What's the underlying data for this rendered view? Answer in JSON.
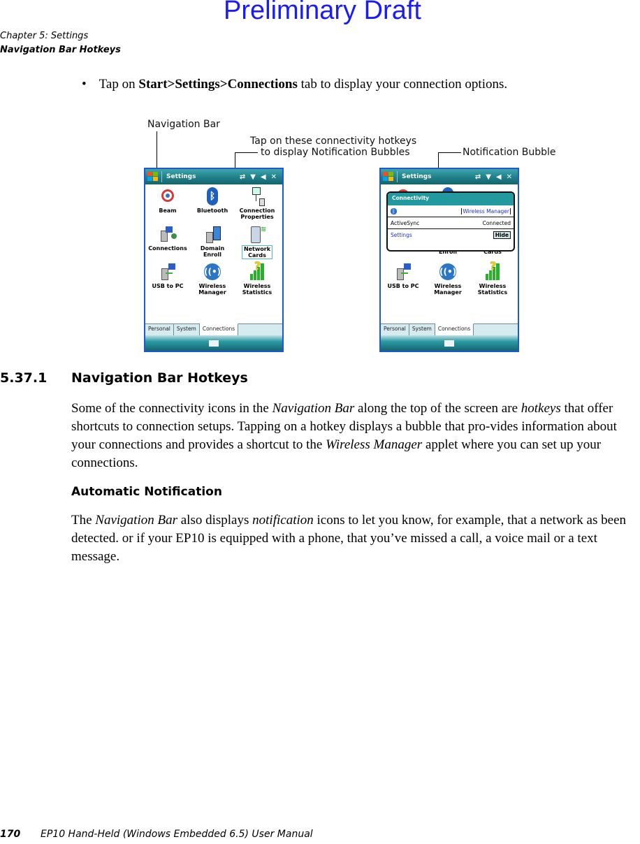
{
  "watermark": "Preliminary Draft",
  "header": {
    "chapter": "Chapter 5:  Settings",
    "section": "Navigation Bar Hotkeys"
  },
  "instruction": {
    "prefix": "Tap on ",
    "bold": "Start>Settings>Connections",
    "suffix": " tab to display your connection options."
  },
  "figure": {
    "callouts": {
      "navigation_bar": "Navigation Bar",
      "hotkeys_line1": "Tap on these connectivity hotkeys",
      "hotkeys_line2": "to display Notification Bubbles",
      "notification_bubble": "Notification Bubble"
    },
    "screen": {
      "title": "Settings",
      "items": [
        {
          "label1": "Beam",
          "label2": "",
          "icon": "beam-icon"
        },
        {
          "label1": "Bluetooth",
          "label2": "",
          "icon": "bluetooth-icon"
        },
        {
          "label1": "Connection",
          "label2": "Properties",
          "icon": "connection-properties-icon"
        },
        {
          "label1": "Connections",
          "label2": "",
          "icon": "connections-icon"
        },
        {
          "label1": "Domain",
          "label2": "Enroll",
          "icon": "domain-enroll-icon"
        },
        {
          "label1": "Network",
          "label2": "Cards",
          "icon": "network-cards-icon"
        },
        {
          "label1": "USB to PC",
          "label2": "",
          "icon": "usb-to-pc-icon"
        },
        {
          "label1": "Wireless",
          "label2": "Manager",
          "icon": "wireless-manager-icon"
        },
        {
          "label1": "Wireless",
          "label2": "Statistics",
          "icon": "wireless-statistics-icon"
        }
      ],
      "tabs": [
        "Personal",
        "System",
        "Connections"
      ],
      "active_tab": "Connections"
    },
    "bubble": {
      "title": "Connectivity",
      "wireless_manager_link": "Wireless Manager",
      "activesync_label": "ActiveSync",
      "activesync_status": "Connected",
      "settings_link": "Settings",
      "hide_button": "Hide"
    },
    "colors": {
      "titlebar": "#1e7f88",
      "device_border": "#1d5ad0",
      "link": "#1a2fd6"
    }
  },
  "section": {
    "number": "5.37.1",
    "title": "Navigation Bar Hotkeys",
    "paragraph": [
      {
        "t": "Some of the connectivity icons in the "
      },
      {
        "t": "Navigation Bar",
        "i": true
      },
      {
        "t": " along the top of the screen are "
      },
      {
        "t": "hotkeys",
        "i": true
      },
      {
        "t": " that offer shortcuts to connection setups. Tapping on a hotkey displays a bubble that pro-vides information about your connections and provides a shortcut to the "
      },
      {
        "t": "Wireless Manager",
        "i": true
      },
      {
        "t": " applet where you can set up your connections."
      }
    ]
  },
  "subsection": {
    "title": "Automatic Notification",
    "paragraph": [
      {
        "t": "The "
      },
      {
        "t": "Navigation Bar",
        "i": true
      },
      {
        "t": " also displays "
      },
      {
        "t": "notification",
        "i": true
      },
      {
        "t": " icons to let you know, for example, that a network as been detected. or if your EP10 is equipped with a phone, that you’ve missed a call, a voice mail or a text message."
      }
    ]
  },
  "footer": {
    "page_number": "170",
    "manual_title": "EP10 Hand-Held (Windows Embedded 6.5) User Manual"
  }
}
